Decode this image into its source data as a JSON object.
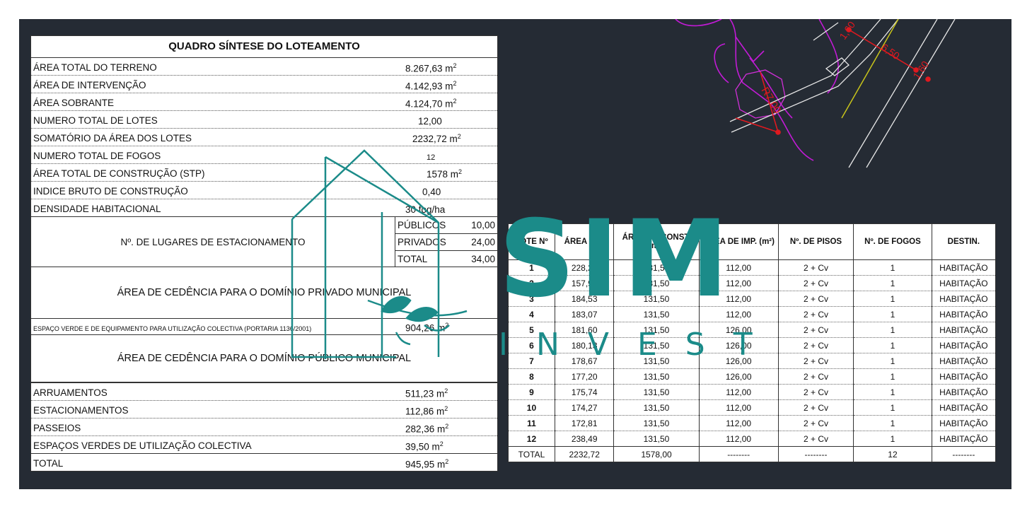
{
  "summary": {
    "title": "QUADRO SÍNTESE DO LOTEAMENTO",
    "rows": [
      {
        "label": "ÁREA TOTAL DO TERRENO",
        "value": "8.267,63 m",
        "unit": "2"
      },
      {
        "label": "ÁREA DE INTERVENÇÃO",
        "value": "4.142,93 m",
        "unit": "2"
      },
      {
        "label": "ÁREA SOBRANTE",
        "value": "4.124,70 m",
        "unit": "2"
      },
      {
        "label": "NUMERO  TOTAL DE LOTES",
        "value": "12,00",
        "unit": ""
      },
      {
        "label": "SOMATÓRIO DA ÁREA DOS LOTES",
        "value": "2232,72 m",
        "unit": "2"
      },
      {
        "label": "NUMERO  TOTAL DE FOGOS",
        "value": "12",
        "unit": ""
      },
      {
        "label": "ÁREA TOTAL DE CONSTRUÇÃO (STP)",
        "value": "1578 m",
        "unit": "2"
      },
      {
        "label": "INDICE BRUTO DE CONSTRUÇÃO",
        "value": "0,40",
        "unit": ""
      },
      {
        "label": "DENSIDADE HABITACIONAL",
        "value": "30 fog/ha",
        "unit": ""
      }
    ],
    "parking": {
      "label": "Nº. DE LUGARES DE ESTACIONAMENTO",
      "items": [
        {
          "label": "PÚBLICOS",
          "value": "10,00"
        },
        {
          "label": "PRIVADOS",
          "value": "24,00"
        },
        {
          "label": "TOTAL",
          "value": "34,00"
        }
      ]
    },
    "cedencia_privado": "ÁREA DE CEDÊNCIA PARA O DOMÍNIO PRIVADO MUNICIPAL",
    "espaco_verde": {
      "label": "ESPAÇO VERDE E DE EQUIPAMENTO PARA UTILIZAÇÃO COLECTIVA (PORTARIA 1136/2001)",
      "value": "904,26 m",
      "unit": "2"
    },
    "cedencia_publico": "ÁREA DE CEDÊNCIA PARA O DOMÍNIO PÚBLICO MUNICIPAL",
    "bottom_rows": [
      {
        "label": "ARRUAMENTOS",
        "value": "511,23 m",
        "unit": "2"
      },
      {
        "label": "ESTACIONAMENTOS",
        "value": "112,86 m",
        "unit": "2"
      },
      {
        "label": "PASSEIOS",
        "value": "282,36 m",
        "unit": "2"
      },
      {
        "label": "ESPAÇOS VERDES DE UTILIZAÇÃO COLECTIVA",
        "value": "39,50 m",
        "unit": "2"
      },
      {
        "label": "TOTAL",
        "value": "945,95 m",
        "unit": "2"
      }
    ]
  },
  "lots": {
    "headers": [
      "LOTE Nº",
      "ÁREA (m²)",
      "ÁREA DE CONST. (m²)",
      "ÁREA DE IMP. (m²)",
      "Nº. DE PISOS",
      "Nº. DE FOGOS",
      "DESTIN."
    ],
    "rows": [
      [
        "1",
        "228,22",
        "131,50",
        "112,00",
        "2 + Cv",
        "1",
        "HABITAÇÃO"
      ],
      [
        "2",
        "157,90",
        "131,50",
        "112,00",
        "2 + Cv",
        "1",
        "HABITAÇÃO"
      ],
      [
        "3",
        "184,53",
        "131,50",
        "112,00",
        "2 + Cv",
        "1",
        "HABITAÇÃO"
      ],
      [
        "4",
        "183,07",
        "131,50",
        "112,00",
        "2 + Cv",
        "1",
        "HABITAÇÃO"
      ],
      [
        "5",
        "181,60",
        "131,50",
        "126,00",
        "2 + Cv",
        "1",
        "HABITAÇÃO"
      ],
      [
        "6",
        "180,13",
        "131,50",
        "126,00",
        "2 + Cv",
        "1",
        "HABITAÇÃO"
      ],
      [
        "7",
        "178,67",
        "131,50",
        "126,00",
        "2 + Cv",
        "1",
        "HABITAÇÃO"
      ],
      [
        "8",
        "177,20",
        "131,50",
        "126,00",
        "2 + Cv",
        "1",
        "HABITAÇÃO"
      ],
      [
        "9",
        "175,74",
        "131,50",
        "112,00",
        "2 + Cv",
        "1",
        "HABITAÇÃO"
      ],
      [
        "10",
        "174,27",
        "131,50",
        "112,00",
        "2 + Cv",
        "1",
        "HABITAÇÃO"
      ],
      [
        "11",
        "172,81",
        "131,50",
        "112,00",
        "2 + Cv",
        "1",
        "HABITAÇÃO"
      ],
      [
        "12",
        "238,49",
        "131,50",
        "112,00",
        "2 + Cv",
        "1",
        "HABITAÇÃO"
      ]
    ],
    "total": [
      "TOTAL",
      "2232,72",
      "1578,00",
      "--------",
      "--------",
      "12",
      "--------"
    ]
  },
  "cad_labels": {
    "radius": "R7,00",
    "dim1": "1,60",
    "dim2": "6,50",
    "dim3": "1,60"
  },
  "watermark": {
    "brand": "SIM",
    "sub": "INVEST"
  },
  "colors": {
    "background": "#252b34",
    "brand": "#1b8b89",
    "cad_magenta": "#c21bd6",
    "cad_red": "#e0191f"
  }
}
